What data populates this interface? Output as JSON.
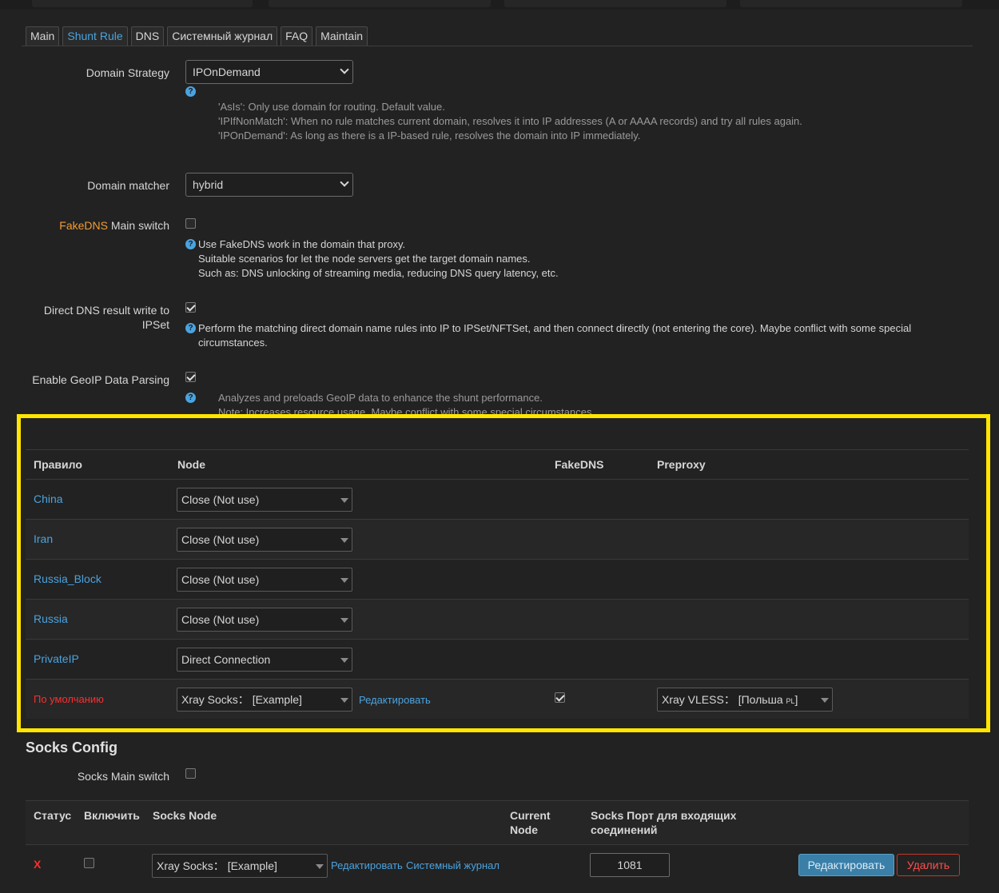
{
  "tabs": [
    {
      "label": "Main"
    },
    {
      "label": "Shunt Rule"
    },
    {
      "label": "DNS"
    },
    {
      "label": "Системный журнал"
    },
    {
      "label": "FAQ"
    },
    {
      "label": "Maintain"
    }
  ],
  "active_tab": "Shunt Rule",
  "domain_strategy": {
    "label": "Domain Strategy",
    "value": "IPOnDemand",
    "help": [
      "'AsIs': Only use domain for routing. Default value.",
      "'IPIfNonMatch': When no rule matches current domain, resolves it into IP addresses (A or AAAA records) and try all rules again.",
      "'IPOnDemand': As long as there is a IP-based rule, resolves the domain into IP immediately."
    ]
  },
  "domain_matcher": {
    "label": "Domain matcher",
    "value": "hybrid"
  },
  "fakedns": {
    "label_prefix": "FakeDNS",
    "label_suffix": " Main switch",
    "checked": false,
    "help": [
      "Use FakeDNS work in the domain that proxy.",
      "Suitable scenarios for let the node servers get the target domain names.",
      "Such as: DNS unlocking of streaming media, reducing DNS query latency, etc."
    ]
  },
  "direct_dns": {
    "label_line1": "Direct DNS result write to",
    "label_line2": "IPSet",
    "checked": true,
    "help": [
      "Perform the matching direct domain name rules into IP to IPSet/NFTSet, and then connect directly (not entering the core). Maybe conflict with some special",
      "circumstances."
    ]
  },
  "geoip": {
    "label": "Enable GeoIP Data Parsing",
    "checked": true,
    "help": [
      "Analyzes and preloads GeoIP data to enhance the shunt performance.",
      "Note: Increases resource usage. Maybe conflict with some special circumstances."
    ]
  },
  "shunt_table": {
    "headers": {
      "rule": "Правило",
      "node": "Node",
      "fakedns": "FakeDNS",
      "preproxy": "Preproxy"
    },
    "rows": [
      {
        "rule": "China",
        "node": "Close (Not use)"
      },
      {
        "rule": "Iran",
        "node": "Close (Not use)"
      },
      {
        "rule": "Russia_Block",
        "node": "Close (Not use)"
      },
      {
        "rule": "Russia",
        "node": "Close (Not use)"
      },
      {
        "rule": "PrivateIP",
        "node": "Direct Connection"
      }
    ],
    "default_row": {
      "rule": "По умолчанию",
      "node": "Xray Socks： [Example]",
      "edit_link": "Редактировать",
      "fakedns_checked": true,
      "preproxy_prefix": "Xray VLESS： [Польша ",
      "preproxy_flag": "PL",
      "preproxy_suffix": "]"
    }
  },
  "socks": {
    "title": "Socks Config",
    "switch_label": "Socks Main switch",
    "switch_checked": false,
    "headers": {
      "status": "Статус",
      "enable": "Включить",
      "node": "Socks Node",
      "current_line1": "Current",
      "current_line2": "Node",
      "port_line1": "Socks Порт для входящих",
      "port_line2": "соединений"
    },
    "row": {
      "status": "X",
      "enabled": false,
      "node": "Xray Socks： [Example]",
      "edit_link": "Редактировать",
      "log_link": "Системный журнал",
      "port": "1081",
      "edit_button": "Редактировать",
      "delete_button": "Удалить"
    }
  },
  "colors": {
    "accent_blue": "#4aa3df",
    "orange": "#f39c33",
    "red": "#ff2d2d",
    "highlight": "#ffe600",
    "background": "#222222"
  }
}
